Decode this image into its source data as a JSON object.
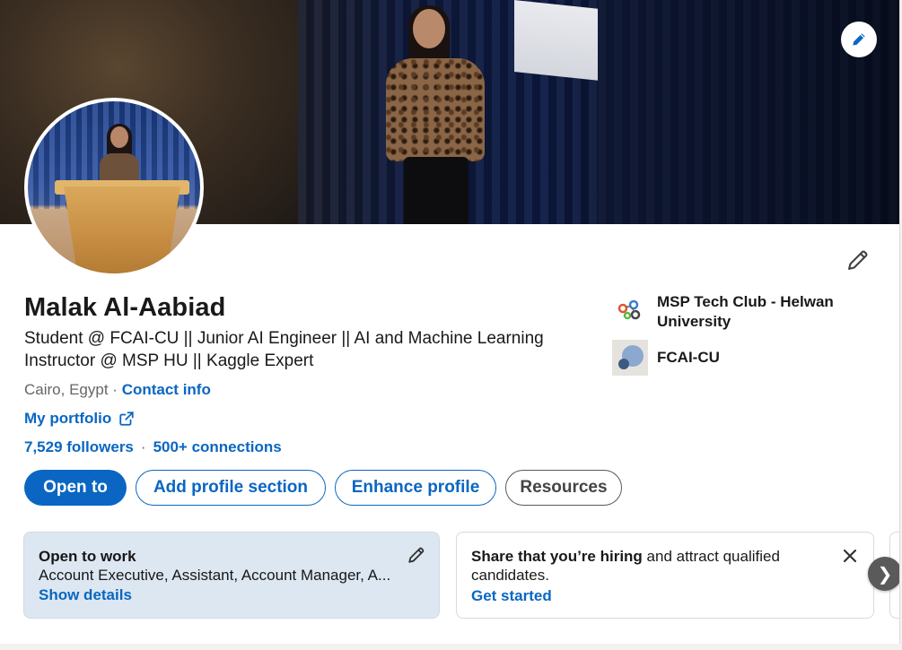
{
  "profile": {
    "name": "Malak Al-Aabiad",
    "headline": "Student @ FCAI-CU || Junior AI Engineer || AI and Machine Learning Instructor @ MSP HU || Kaggle Expert",
    "location": "Cairo, Egypt",
    "separator": "·",
    "contact_info": "Contact info",
    "portfolio_label": "My portfolio",
    "followers": "7,529 followers",
    "connections": "500+ connections"
  },
  "organizations": [
    {
      "name": "MSP Tech Club - Helwan University",
      "icon": "msp-logo-icon"
    },
    {
      "name": "FCAI-CU",
      "icon": "fcai-logo-icon"
    }
  ],
  "actions": {
    "open_to": "Open to",
    "add_profile_section": "Add profile section",
    "enhance_profile": "Enhance profile",
    "resources": "Resources"
  },
  "open_to_work": {
    "title": "Open to work",
    "roles": "Account Executive, Assistant, Account Manager, A...",
    "show_details": "Show details"
  },
  "hiring": {
    "bold": "Share that you’re hiring",
    "rest": " and attract qualified candidates.",
    "cta": "Get started"
  },
  "carousel": {
    "next_glyph": "❯"
  },
  "colors": {
    "brand_blue": "#0a66c2",
    "open_to_work_bg": "#dde7f1",
    "text_primary": "#191919",
    "text_secondary": "#666666"
  }
}
